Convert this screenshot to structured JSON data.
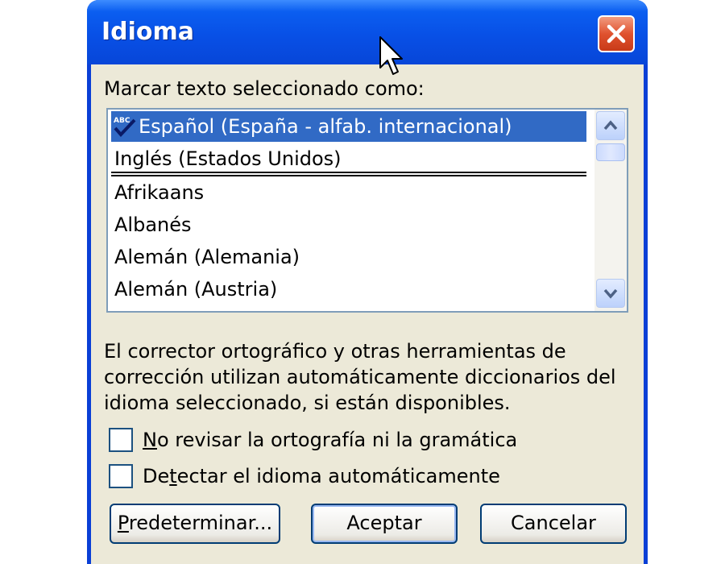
{
  "dialog": {
    "title": "Idioma",
    "list_label": "Marcar texto seleccionado como:",
    "languages": [
      "Español (España - alfab. internacional)",
      "Inglés (Estados Unidos)",
      "Afrikaans",
      "Albanés",
      "Alemán (Alemania)",
      "Alemán (Austria)"
    ],
    "selected_language": "Español (España - alfab. internacional)",
    "description": "El corrector ortográfico y otras herramientas de corrección utilizan automáticamente diccionarios del idioma seleccionado, si están disponibles.",
    "checkboxes": [
      {
        "label_key": "N",
        "label_rest": "o revisar la ortografía ni la gramática",
        "checked": false
      },
      {
        "label_key": "D",
        "label_first": "e",
        "label_key2": "t",
        "label_rest": "ectar el idioma automáticamente",
        "checked": false
      }
    ],
    "buttons": {
      "default_key": "P",
      "default_rest": "redeterminar...",
      "accept": "Aceptar",
      "cancel": "Cancelar"
    }
  },
  "icons": {
    "close": "close-icon",
    "spellcheck": "abc-check-icon",
    "scroll_up": "chevron-up-icon",
    "scroll_down": "chevron-down-icon",
    "cursor": "mouse-pointer-icon"
  },
  "colors": {
    "title_bar": "#0850e6",
    "selection": "#316ac5",
    "dialog_face": "#ece9d8",
    "close_button": "#e0522f"
  }
}
